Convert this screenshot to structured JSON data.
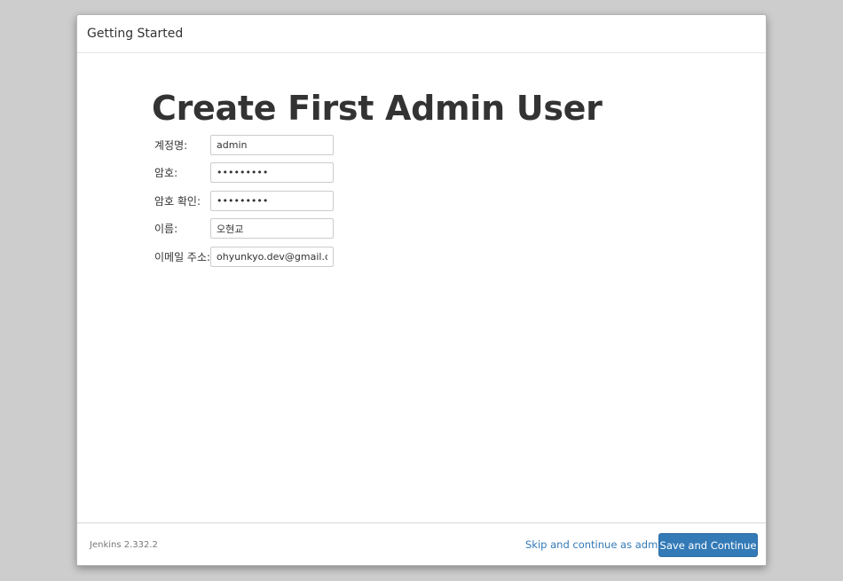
{
  "header": {
    "title": "Getting Started"
  },
  "main": {
    "heading": "Create First Admin User",
    "fields": [
      {
        "label": "계정명:",
        "value": "admin",
        "type": "text"
      },
      {
        "label": "암호:",
        "value": "•••••••••",
        "type": "password"
      },
      {
        "label": "암호 확인:",
        "value": "•••••••••",
        "type": "password"
      },
      {
        "label": "이름:",
        "value": "오현교",
        "type": "text"
      },
      {
        "label": "이메일 주소:",
        "value": "ohyunkyo.dev@gmail.com",
        "type": "text"
      }
    ]
  },
  "footer": {
    "version": "Jenkins 2.332.2",
    "skip_label": "Skip and continue as admin",
    "save_label": "Save and Continue"
  },
  "colors": {
    "accent": "#337ab7",
    "background": "#cdcdcd"
  }
}
